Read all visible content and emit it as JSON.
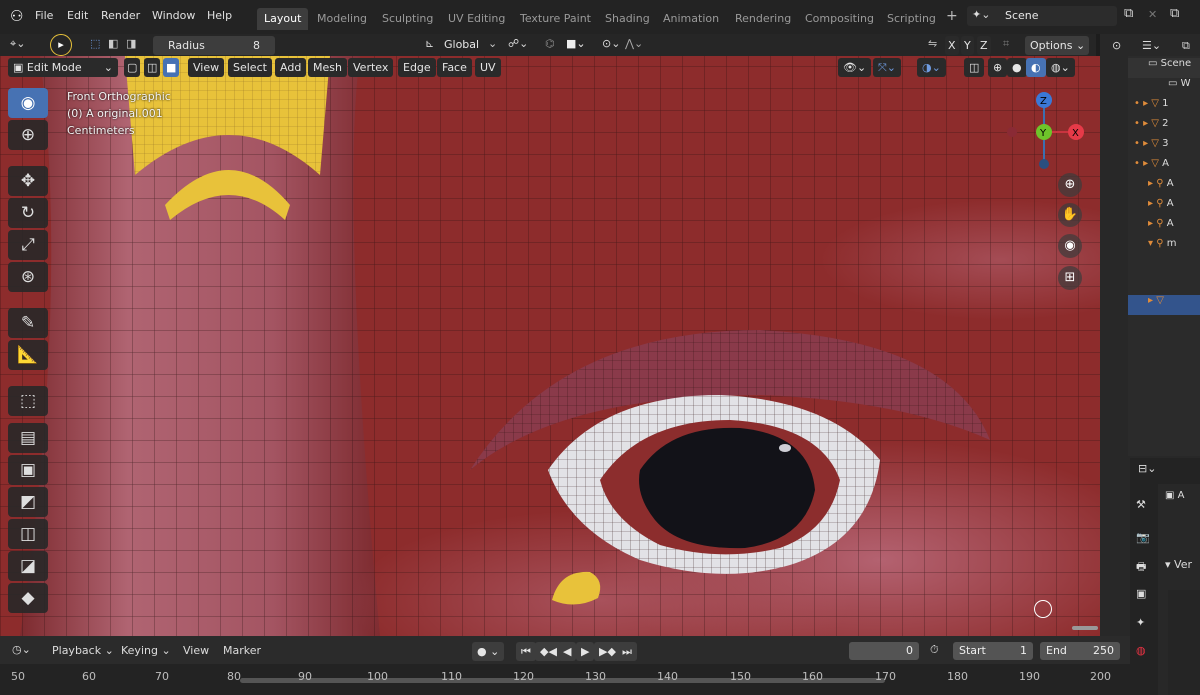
{
  "menu": {
    "items": [
      "File",
      "Edit",
      "Render",
      "Window",
      "Help"
    ]
  },
  "workspaces": [
    {
      "label": "Layout",
      "active": true
    },
    {
      "label": "Modeling"
    },
    {
      "label": "Sculpting"
    },
    {
      "label": "UV Editing"
    },
    {
      "label": "Texture Paint"
    },
    {
      "label": "Shading"
    },
    {
      "label": "Animation"
    },
    {
      "label": "Rendering"
    },
    {
      "label": "Compositing"
    },
    {
      "label": "Scripting"
    }
  ],
  "add_ws": "+",
  "scene": {
    "name": "Scene"
  },
  "tool_header": {
    "radius_label": "Radius",
    "radius_value": "8",
    "orientation": "Global",
    "options": "Options"
  },
  "axes_buttons": [
    "X",
    "Y",
    "Z"
  ],
  "viewport_header": {
    "mode": "Edit Mode",
    "menus": [
      "View",
      "Select",
      "Add",
      "Mesh",
      "Vertex",
      "Edge",
      "Face",
      "UV"
    ]
  },
  "overlay": {
    "view_name": "Front Orthographic",
    "object": "(0) A original.001",
    "units": "Centimeters"
  },
  "gizmo": {
    "z": "Z",
    "y": "Y",
    "x": "X"
  },
  "outliner": {
    "rows": [
      "Scene",
      "W",
      "1",
      "2",
      "3",
      "A",
      "A",
      "A",
      "A",
      "m"
    ]
  },
  "properties": {
    "rows": [
      "A",
      "Ver"
    ]
  },
  "timeline": {
    "menus": [
      "Playback",
      "Keying",
      "View",
      "Marker"
    ],
    "current_frame": "0",
    "start_label": "Start",
    "start": "1",
    "end_label": "End",
    "end": "250",
    "ticks": [
      "50",
      "60",
      "70",
      "80",
      "90",
      "100",
      "110",
      "120",
      "130",
      "140",
      "150",
      "160",
      "170",
      "180",
      "190",
      "200"
    ]
  },
  "colors": {
    "accent": "#4772b3",
    "selection": "#e8c23a",
    "mesh": "#8c2b2b"
  }
}
